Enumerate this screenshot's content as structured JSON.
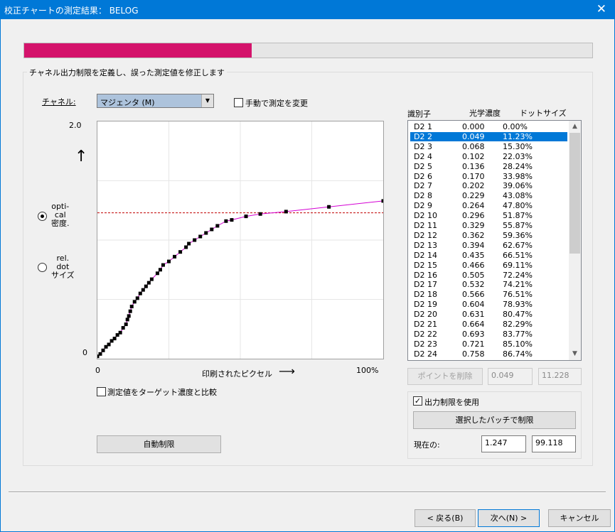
{
  "window": {
    "title": "校正チャートの測定結果： BELOG"
  },
  "progress": {
    "fraction": 0.4
  },
  "group": {
    "title": "チャネル出力制限を定義し、誤った測定値を修正します"
  },
  "channel": {
    "label": "チャネル:",
    "value": "マジェンタ (M)"
  },
  "manual_change": {
    "label": "手動で測定を変更",
    "checked": false
  },
  "axis": {
    "y_top": "2.0",
    "y_bottom": "0",
    "x_left": "0",
    "x_right": "100%",
    "x_label": "印刷されたピクセル",
    "up_arrow": "↑",
    "right_arrow": "⟶"
  },
  "mode": {
    "optical_line1": "opti-",
    "optical_line2": "cal",
    "optical_line3": "密度.",
    "dot_line1": "rel.",
    "dot_line2": "dot",
    "dot_line3": "サイズ",
    "selected": "optical"
  },
  "compare": {
    "label": "測定値をターゲット濃度と比較",
    "checked": false
  },
  "auto_limit": {
    "label": "自動制限"
  },
  "table": {
    "headers": {
      "id": "識別子",
      "density": "光学濃度",
      "dot": "ドットサイズ"
    },
    "selected_index": 1,
    "rows": [
      [
        "D2 1",
        "0.000",
        "0.00%"
      ],
      [
        "D2 2",
        "0.049",
        "11.23%"
      ],
      [
        "D2 3",
        "0.068",
        "15.30%"
      ],
      [
        "D2 4",
        "0.102",
        "22.03%"
      ],
      [
        "D2 5",
        "0.136",
        "28.24%"
      ],
      [
        "D2 6",
        "0.170",
        "33.98%"
      ],
      [
        "D2 7",
        "0.202",
        "39.06%"
      ],
      [
        "D2 8",
        "0.229",
        "43.08%"
      ],
      [
        "D2 9",
        "0.264",
        "47.80%"
      ],
      [
        "D2 10",
        "0.296",
        "51.87%"
      ],
      [
        "D2 11",
        "0.329",
        "55.87%"
      ],
      [
        "D2 12",
        "0.362",
        "59.36%"
      ],
      [
        "D2 13",
        "0.394",
        "62.67%"
      ],
      [
        "D2 14",
        "0.435",
        "66.51%"
      ],
      [
        "D2 15",
        "0.466",
        "69.11%"
      ],
      [
        "D2 16",
        "0.505",
        "72.24%"
      ],
      [
        "D2 17",
        "0.532",
        "74.21%"
      ],
      [
        "D2 18",
        "0.566",
        "76.51%"
      ],
      [
        "D2 19",
        "0.604",
        "78.93%"
      ],
      [
        "D2 20",
        "0.631",
        "80.47%"
      ],
      [
        "D2 21",
        "0.664",
        "82.29%"
      ],
      [
        "D2 22",
        "0.693",
        "83.77%"
      ],
      [
        "D2 23",
        "0.721",
        "85.10%"
      ],
      [
        "D2 24",
        "0.758",
        "86.74%"
      ]
    ]
  },
  "point_edit": {
    "delete_label": "ポイントを削除",
    "density": "0.049",
    "dot": "11.228"
  },
  "output_limit": {
    "use_label": "出力制限を使用",
    "checked": true,
    "patch_button": "選択したパッチで制限",
    "current_label": "現在の:",
    "current_density": "1.247",
    "current_dot": "99.118"
  },
  "footer": {
    "back": "< 戻る(B)",
    "next": "次へ(N) >",
    "cancel": "キャンセル"
  },
  "chart_data": {
    "type": "scatter",
    "title": "",
    "xlabel": "印刷されたピクセル",
    "ylabel": "",
    "xlim": [
      0,
      100
    ],
    "ylim": [
      0,
      2.0
    ],
    "x_tick_labels": [
      "0",
      "100%"
    ],
    "y_tick_labels": [
      "0",
      "2.0"
    ],
    "limit_line_y": 1.23,
    "colors": {
      "fit": "#d400d4",
      "limit": "#c00000",
      "points": "#000000"
    },
    "points": [
      [
        0,
        0.02
      ],
      [
        1,
        0.04
      ],
      [
        2,
        0.07
      ],
      [
        3,
        0.1
      ],
      [
        4,
        0.12
      ],
      [
        5,
        0.15
      ],
      [
        6,
        0.17
      ],
      [
        7,
        0.2
      ],
      [
        8,
        0.22
      ],
      [
        9,
        0.26
      ],
      [
        10,
        0.29
      ],
      [
        10.5,
        0.33
      ],
      [
        11,
        0.36
      ],
      [
        11.5,
        0.4
      ],
      [
        12,
        0.44
      ],
      [
        13,
        0.48
      ],
      [
        14,
        0.51
      ],
      [
        15,
        0.55
      ],
      [
        16,
        0.58
      ],
      [
        17,
        0.61
      ],
      [
        18,
        0.64
      ],
      [
        19,
        0.67
      ],
      [
        21,
        0.72
      ],
      [
        22,
        0.75
      ],
      [
        23,
        0.79
      ],
      [
        25,
        0.82
      ],
      [
        27,
        0.86
      ],
      [
        29,
        0.9
      ],
      [
        31,
        0.94
      ],
      [
        32,
        0.97
      ],
      [
        34,
        1.0
      ],
      [
        36,
        1.03
      ],
      [
        38,
        1.06
      ],
      [
        40,
        1.09
      ],
      [
        42,
        1.12
      ],
      [
        45,
        1.16
      ],
      [
        47,
        1.17
      ],
      [
        52,
        1.2
      ],
      [
        57,
        1.22
      ],
      [
        66,
        1.24
      ],
      [
        81,
        1.28
      ],
      [
        100,
        1.33
      ]
    ]
  }
}
